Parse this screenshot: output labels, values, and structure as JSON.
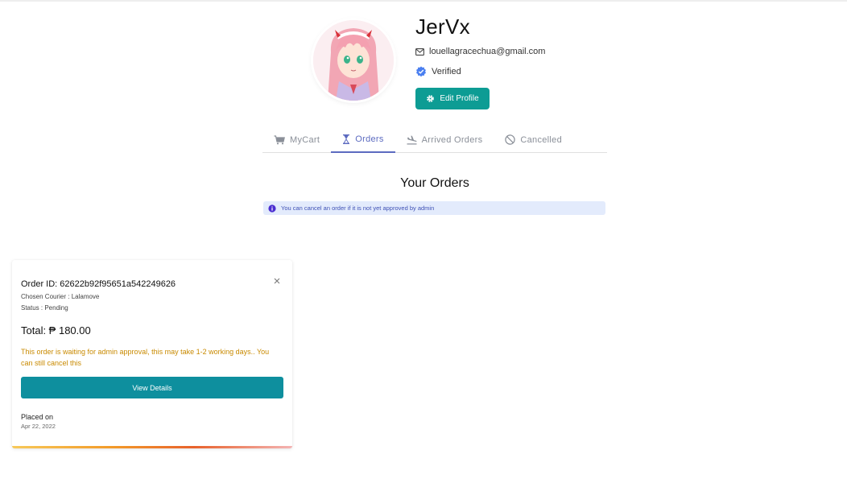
{
  "profile": {
    "username": "JerVx",
    "email": "louellagracechua@gmail.com",
    "verified_label": "Verified",
    "edit_button": "Edit Profile",
    "avatar_icon": "avatar-anime-girl"
  },
  "tabs": [
    {
      "label": "MyCart",
      "icon": "cart-icon",
      "active": false
    },
    {
      "label": "Orders",
      "icon": "hourglass-icon",
      "active": true
    },
    {
      "label": "Arrived Orders",
      "icon": "plane-landing-icon",
      "active": false
    },
    {
      "label": "Cancelled",
      "icon": "block-icon",
      "active": false
    }
  ],
  "orders_section": {
    "title": "Your Orders",
    "info": "You can cancel an order if it is not yet approved by admin"
  },
  "order": {
    "id_label": "Order ID: 62622b92f95651a542249626",
    "courier": "Chosen Courier : Lalamove",
    "status": "Status : Pending",
    "total": "Total: ₱ 180.00",
    "warning": "This order is waiting for admin approval, this may take 1-2 working days.. You can still cancel this",
    "view_button": "View Details",
    "placed_label": "Placed on",
    "placed_date": "Apr 22, 2022"
  },
  "colors": {
    "primary_teal": "#0d9c94",
    "view_button": "#0e8f9e",
    "tab_active": "#5c6bc0",
    "warning_text": "#c98a00",
    "info_bg": "#e3ebfc",
    "verified_badge": "#4a7ff0"
  }
}
